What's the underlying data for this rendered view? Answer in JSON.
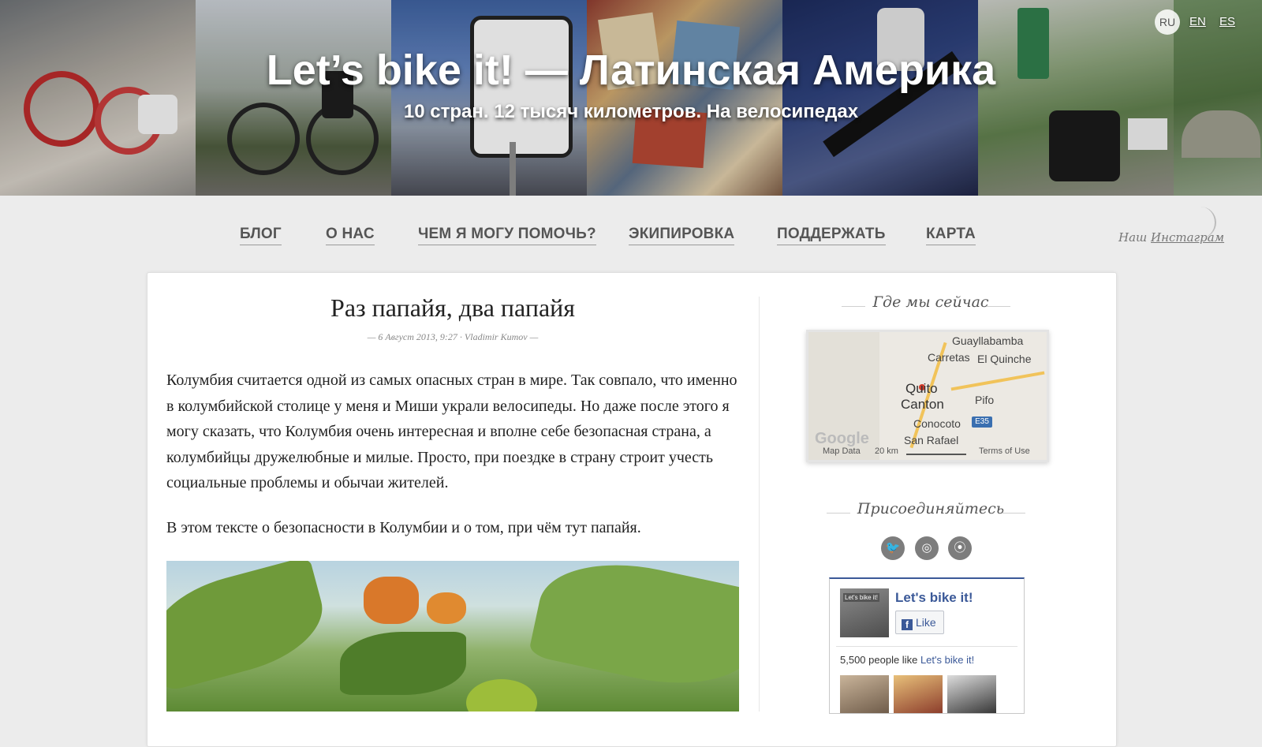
{
  "header": {
    "title": "Let’s bike it! — Латинская Америка",
    "subtitle": "10 стран. 12 тысяч километров. На велосипедах",
    "languages": [
      {
        "label": "RU",
        "active": true
      },
      {
        "label": "EN",
        "active": false
      },
      {
        "label": "ES",
        "active": false
      }
    ]
  },
  "nav": {
    "items": [
      "БЛОГ",
      "О НАС",
      "ЧЕМ Я МОГУ ПОМОЧЬ?",
      "ЭКИПИРОВКА",
      "ПОДДЕРЖАТЬ",
      "КАРТА"
    ],
    "instagram_prefix": "Наш",
    "instagram_link": "Инстаграм"
  },
  "post": {
    "title": "Раз папайя, два папайя",
    "meta": "— 6 Август 2013, 9:27 · Vladimir Kumov —",
    "paragraphs": [
      "Колумбия считается одной из самых опасных стран в мире. Так совпало, что именно в колумбийской столице у меня и Миши украли велосипеды. Но даже после этого я могу сказать, что Колумбия очень интересная и вполне себе безопасная страна, а колумбийцы дружелюбные и милые. Просто, при поездке в страну строит учесть социальные проблемы и обычаи жителей.",
      "В этом тексте о безопасности в Колумбии и о том, при чём тут папайя."
    ]
  },
  "sidebar": {
    "location_heading": "Где мы сейчас",
    "map": {
      "labels": [
        "Guayllabamba",
        "Carretas",
        "El Quinche",
        "Quito",
        "Canton",
        "Pifo",
        "Conocoto",
        "San Rafael",
        "E35"
      ],
      "footer_data": "Map Data",
      "footer_scale": "20 km",
      "footer_terms": "Terms of Use",
      "brand": "Google"
    },
    "join_heading": "Присоединяйтесь",
    "social_icons": [
      "twitter-icon",
      "instagram-icon",
      "rss-icon"
    ],
    "facebook": {
      "thumb_label": "Let's bike it!",
      "page_name": "Let's bike it!",
      "like_label": "Like",
      "count_text": "5,500 people like",
      "count_link": "Let's bike it!"
    }
  },
  "colors": {
    "facebook_blue": "#3b5998",
    "nav_text": "#555555",
    "background": "#ececec"
  }
}
